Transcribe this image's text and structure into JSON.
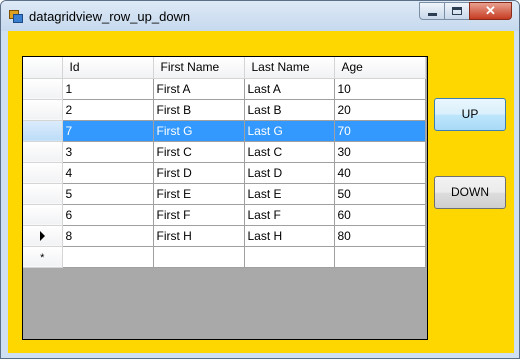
{
  "window": {
    "title": "datagridview_row_up_down",
    "client_color": "#FFD700",
    "selection_color": "#3399FF"
  },
  "grid": {
    "columns": [
      "Id",
      "First Name",
      "Last Name",
      "Age"
    ],
    "rows": [
      {
        "id": "1",
        "first": "First A",
        "last": "Last A",
        "age": "10",
        "selected": false,
        "current": false
      },
      {
        "id": "2",
        "first": "First B",
        "last": "Last B",
        "age": "20",
        "selected": false,
        "current": false
      },
      {
        "id": "7",
        "first": "First G",
        "last": "Last G",
        "age": "70",
        "selected": true,
        "current": false
      },
      {
        "id": "3",
        "first": "First C",
        "last": "Last C",
        "age": "30",
        "selected": false,
        "current": false
      },
      {
        "id": "4",
        "first": "First D",
        "last": "Last D",
        "age": "40",
        "selected": false,
        "current": false
      },
      {
        "id": "5",
        "first": "First E",
        "last": "Last E",
        "age": "50",
        "selected": false,
        "current": false
      },
      {
        "id": "6",
        "first": "First F",
        "last": "Last F",
        "age": "60",
        "selected": false,
        "current": false
      },
      {
        "id": "8",
        "first": "First H",
        "last": "Last H",
        "age": "80",
        "selected": false,
        "current": true
      }
    ],
    "new_row_glyph": "*"
  },
  "buttons": {
    "up_label": "UP",
    "down_label": "DOWN"
  }
}
